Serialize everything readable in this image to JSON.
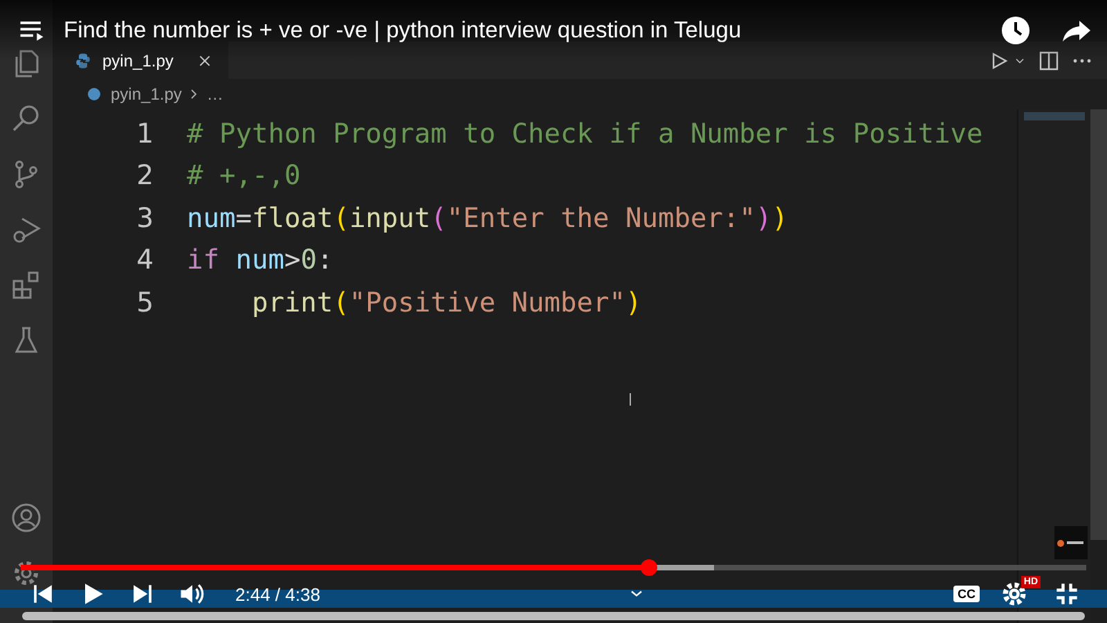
{
  "video": {
    "title": "Find the number is + ve or -ve | python interview question in Telugu"
  },
  "editor": {
    "tabs": [
      {
        "label": "pyin_1.py",
        "selected": true
      }
    ],
    "breadcrumb": [
      "pyin_1.py",
      "…"
    ],
    "lines": [
      {
        "number": "1",
        "tokens": [
          {
            "text": "# Python Program to Check if a Number is Positive",
            "kind": "comment"
          }
        ]
      },
      {
        "number": "2",
        "tokens": [
          {
            "text": "# +,-,0",
            "kind": "comment"
          }
        ]
      },
      {
        "number": "3",
        "tokens": [
          {
            "text": "num",
            "kind": "variable"
          },
          {
            "text": "=",
            "kind": "operator"
          },
          {
            "text": "float",
            "kind": "function"
          },
          {
            "text": "(",
            "kind": "bracket"
          },
          {
            "text": "input",
            "kind": "function"
          },
          {
            "text": "(",
            "kind": "bracket2"
          },
          {
            "text": "\"Enter the Number:\"",
            "kind": "string"
          },
          {
            "text": ")",
            "kind": "bracket2"
          },
          {
            "text": ")",
            "kind": "bracket"
          }
        ]
      },
      {
        "number": "4",
        "tokens": [
          {
            "text": "if",
            "kind": "keyword"
          },
          {
            "text": "num",
            "kind": "variable",
            "spaced": true
          },
          {
            "text": ">",
            "kind": "operator"
          },
          {
            "text": "0",
            "kind": "number"
          },
          {
            "text": ":",
            "kind": "operator"
          }
        ],
        "children": [
          {
            "number": "5",
            "tokens": [
              {
                "text": "print",
                "kind": "function"
              },
              {
                "text": "(",
                "kind": "bracket"
              },
              {
                "text": "\"Positive Number\"",
                "kind": "string"
              },
              {
                "text": ")",
                "kind": "bracket"
              }
            ]
          }
        ]
      }
    ]
  },
  "player": {
    "progress": {
      "level": 0.59
    },
    "buffer": {
      "level": 0.65
    },
    "time": "2:44 / 4:38",
    "captions": "CC",
    "quality_badge": "HD"
  }
}
